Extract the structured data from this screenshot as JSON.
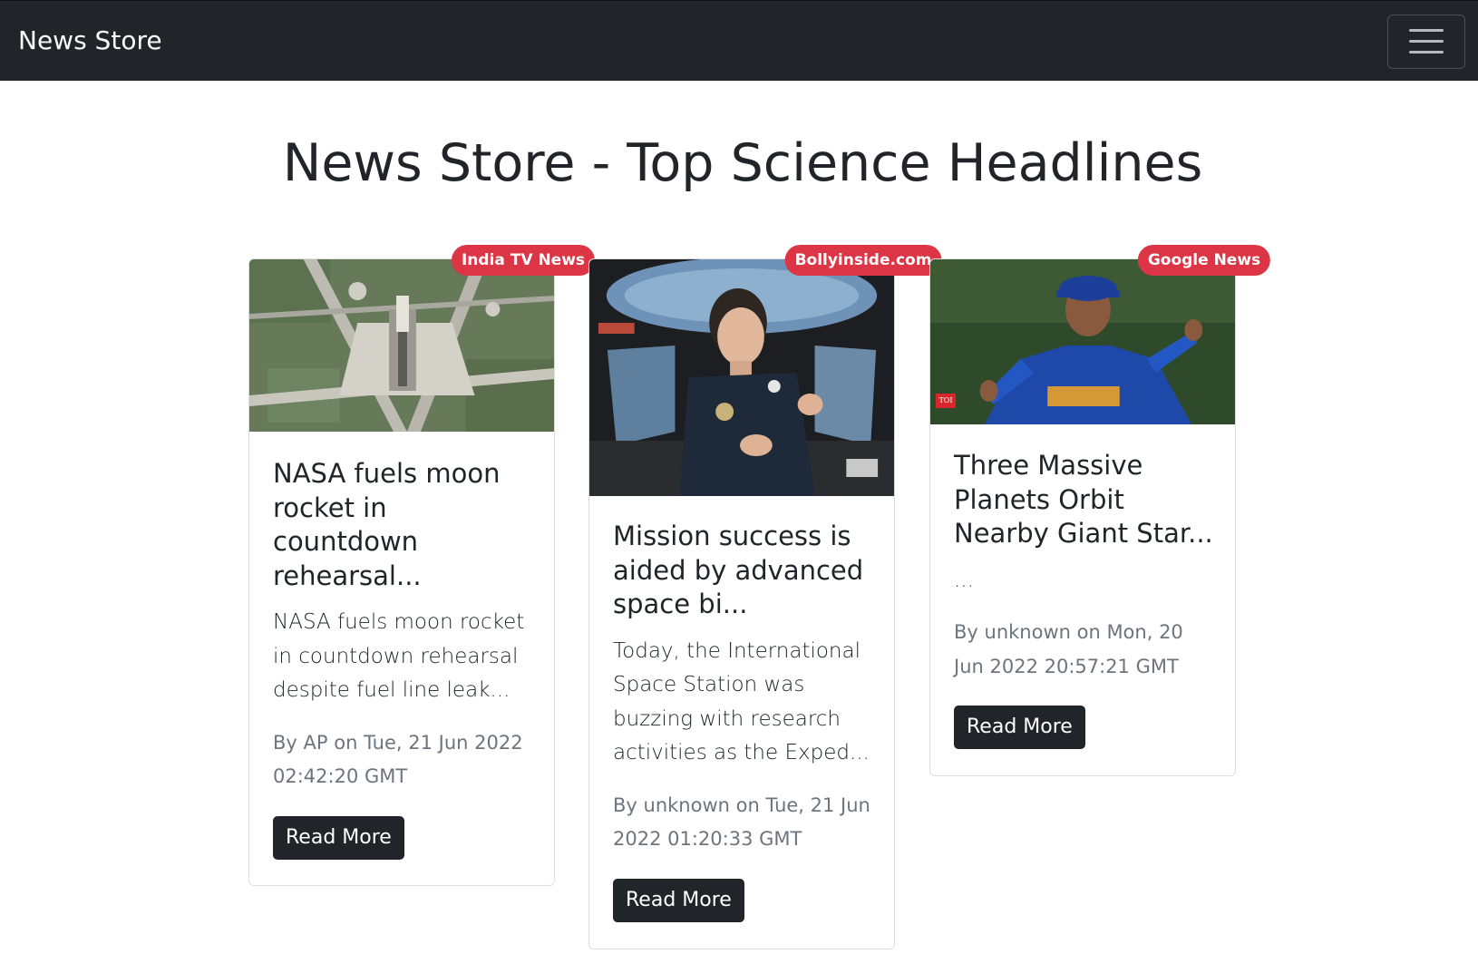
{
  "navbar": {
    "brand": "News Store",
    "menu_icon": "hamburger-menu-icon"
  },
  "page": {
    "title": "News Store - Top Science Headlines"
  },
  "articles": [
    {
      "source": "India TV News",
      "image": "rocket-launch-pad-aerial-photo",
      "title": "NASA fuels moon rocket in countdown rehearsal...",
      "description": "NASA fuels moon rocket in countdown rehearsal despite fuel line leak...",
      "meta": "By AP on Tue, 21 Jun 2022 02:42:20 GMT",
      "button": "Read More"
    },
    {
      "source": "Bollyinside.com",
      "image": "astronaut-in-space-station-cupola-photo",
      "title": "Mission success is aided by advanced space bi...",
      "description": "Today, the International Space Station was buzzing with research activities as the Exped...",
      "meta": "By unknown on Tue, 21 Jun 2022 01:20:33 GMT",
      "button": "Read More"
    },
    {
      "source": "Google News",
      "image": "cricket-player-india-jersey-photo",
      "title": "Three Massive Planets Orbit Nearby Giant Star...",
      "description": "...",
      "meta": "By unknown on Mon, 20 Jun 2022 20:57:21 GMT",
      "button": "Read More",
      "image_watermark": "TOI"
    }
  ],
  "colors": {
    "navbar_bg": "#212529",
    "badge": "#dc3545",
    "button_bg": "#212529",
    "meta_text": "#6c757d"
  }
}
